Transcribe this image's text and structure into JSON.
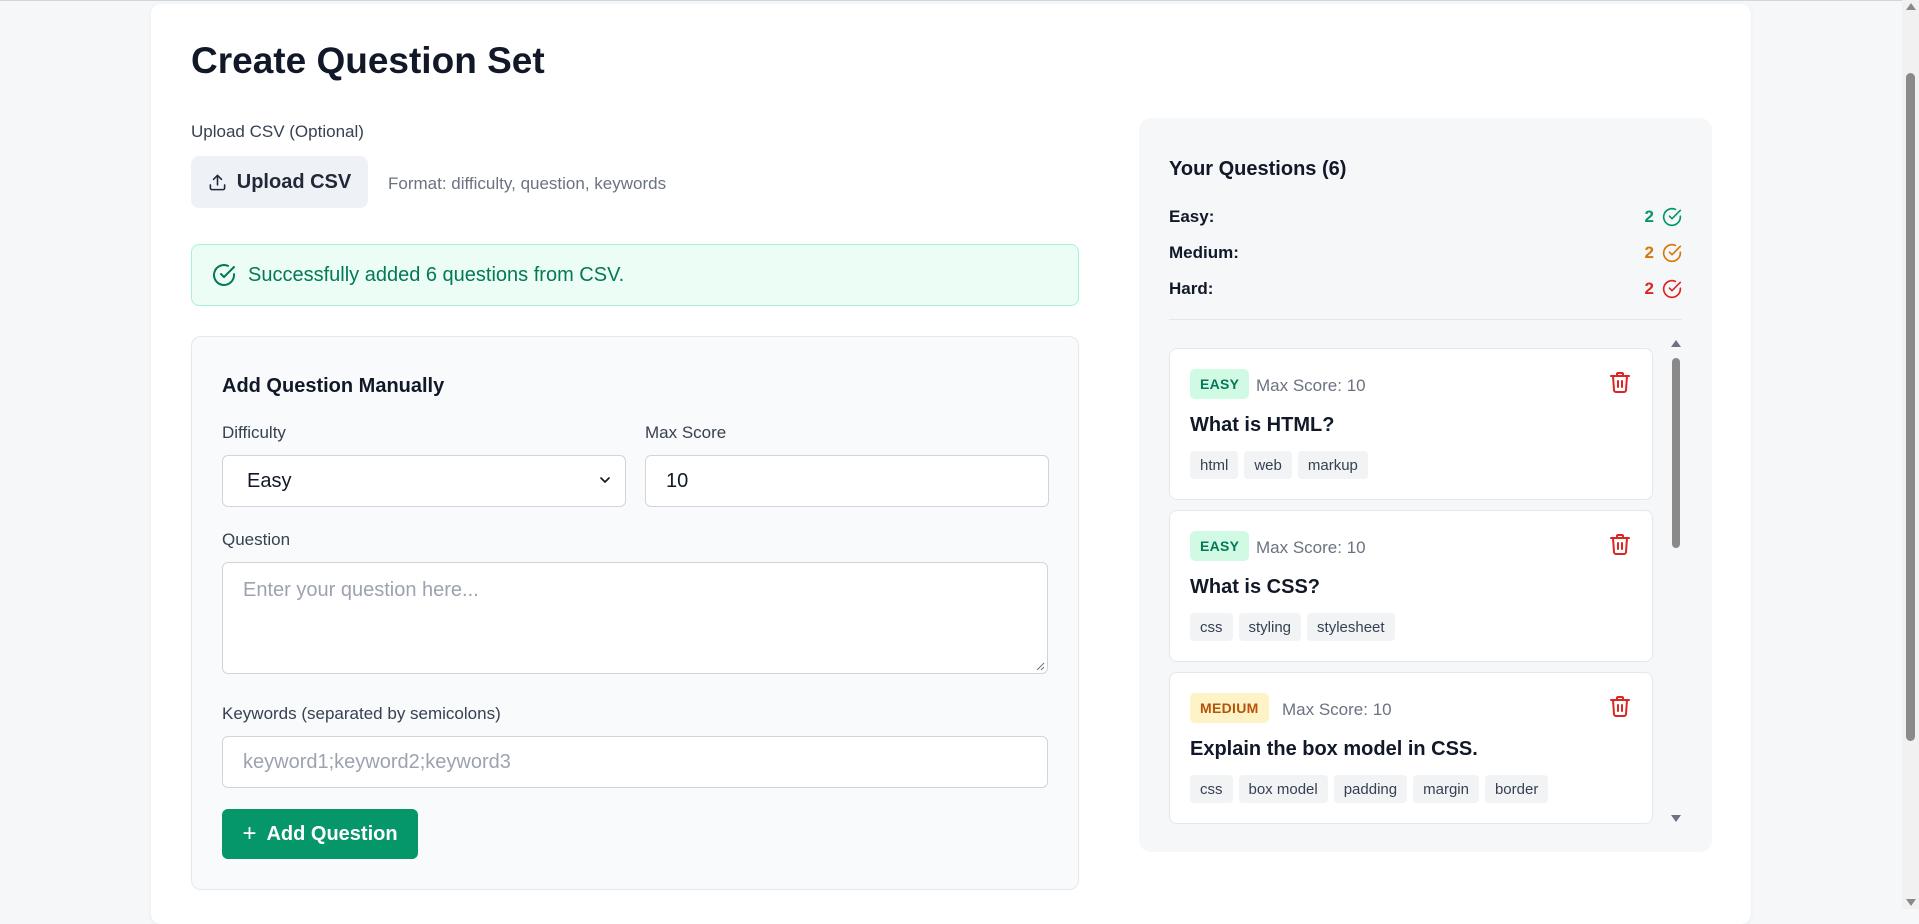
{
  "page": {
    "title": "Create Question Set"
  },
  "upload": {
    "label": "Upload CSV (Optional)",
    "button_label": "Upload CSV",
    "format_hint": "Format: difficulty, question, keywords"
  },
  "alert": {
    "message": "Successfully added 6 questions from CSV."
  },
  "manual": {
    "title": "Add Question Manually",
    "difficulty_label": "Difficulty",
    "difficulty_value": "Easy",
    "max_score_label": "Max Score",
    "max_score_value": "10",
    "question_label": "Question",
    "question_placeholder": "Enter your question here...",
    "keywords_label": "Keywords (separated by semicolons)",
    "keywords_placeholder": "keyword1;keyword2;keyword3",
    "add_button_label": "Add Question"
  },
  "questions_panel": {
    "title": "Your Questions (6)",
    "counts": [
      {
        "label": "Easy:",
        "value": "2",
        "color": "#059669"
      },
      {
        "label": "Medium:",
        "value": "2",
        "color": "#d97706"
      },
      {
        "label": "Hard:",
        "value": "2",
        "color": "#dc2626"
      }
    ],
    "questions": [
      {
        "difficulty": "EASY",
        "max_score": "Max Score: 10",
        "text": "What is HTML?",
        "tags": [
          "html",
          "web",
          "markup"
        ]
      },
      {
        "difficulty": "EASY",
        "max_score": "Max Score: 10",
        "text": "What is CSS?",
        "tags": [
          "css",
          "styling",
          "stylesheet"
        ]
      },
      {
        "difficulty": "MEDIUM",
        "max_score": "Max Score: 10",
        "text": "Explain the box model in CSS.",
        "tags": [
          "css",
          "box model",
          "padding",
          "margin",
          "border"
        ]
      }
    ]
  },
  "colors": {
    "accent": "#059669",
    "danger": "#dc2626",
    "warning": "#d97706"
  }
}
